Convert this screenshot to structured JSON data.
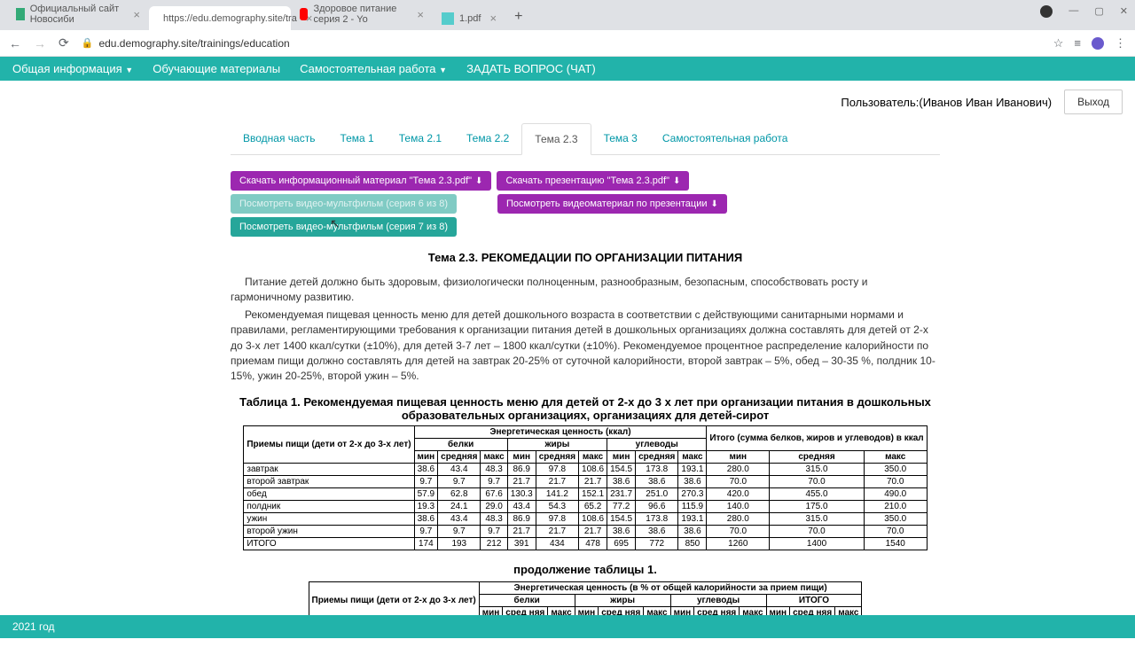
{
  "chrome": {
    "tabs": [
      "Официальный сайт Новосиби",
      "https://edu.demography.site/tra",
      "Здоровое питание серия 2 - Yo",
      "1.pdf"
    ],
    "new_tab": "+",
    "nav": {
      "back": "←",
      "forward": "→",
      "reload": "⟳"
    },
    "lock": "🔒",
    "url": "edu.demography.site/trainings/education",
    "star": "☆",
    "menu": "⋮",
    "close": "×",
    "win": {
      "min": "—",
      "max": "▢",
      "close": "✕"
    }
  },
  "site_nav": [
    "Общая информация",
    "Обучающие материалы",
    "Самостоятельная работа",
    "ЗАДАТЬ ВОПРОС (ЧАТ)"
  ],
  "user_row": {
    "label": "Пользователь:(Иванов Иван Иванович)",
    "logout": "Выход"
  },
  "tabs": [
    "Вводная часть",
    "Тема 1",
    "Тема 2.1",
    "Тема 2.2",
    "Тема 2.3",
    "Тема 3",
    "Самостоятельная работа"
  ],
  "active_tab": 4,
  "buttons": {
    "dl_info": "Скачать информационный материал \"Тема 2.3.pdf\"",
    "dl_pres": "Скачать презентацию \"Тема 2.3.pdf\"",
    "vid6": "Посмотреть видео-мультфильм (серия 6 из 8)",
    "vid7": "Посмотреть видео-мультфильм (серия 7 из 8)",
    "vid_pres": "Посмотреть видеоматериал по презентации"
  },
  "topic_title": "Тема 2.3. РЕКОМЕДАЦИИ ПО ОРГАНИЗАЦИИ ПИТАНИЯ",
  "para1": "Питание детей должно быть здоровым, физиологически полноценным, разнообразным, безопасным, способствовать росту и гармоничному развитию.",
  "para2": "Рекомендуемая пищевая ценность меню для детей дошкольного возраста в соответствии с действующими санитарными нормами и правилами, регламентирующими требования к организации питания детей в дошкольных организациях должна составлять для детей от 2-х до 3-х лет 1400 ккал/сутки (±10%), для детей 3-7 лет – 1800 ккал/сутки (±10%). Рекомендуемое процентное распределение калорийности по приемам пищи должно составлять для детей на завтрак 20-25% от суточной калорийности, второй завтрак – 5%, обед – 30-35 %, полдник 10-15%, ужин 20-25%, второй ужин – 5%.",
  "tbl_caption": "Таблица 1. Рекомендуемая пищевая ценность меню для детей от 2-х до 3 х лет при организации питания в дошкольных образовательных организациях, организациях для детей-сирот",
  "tbl_cont": "продолжение таблицы 1.",
  "footer": "2021 год",
  "t1": {
    "rowhead": "Приемы пищи (дети от 2-х до 3-х лет)",
    "e_title": "Энергетическая ценность (ккал)",
    "total_title": "Итого (сумма белков, жиров и углеводов) в ккал",
    "groups": [
      "белки",
      "жиры",
      "углеводы"
    ],
    "sub": [
      "мин",
      "средняя",
      "макс"
    ],
    "rows": [
      {
        "n": "завтрак",
        "v": [
          "38.6",
          "43.4",
          "48.3",
          "86.9",
          "97.8",
          "108.6",
          "154.5",
          "173.8",
          "193.1",
          "280.0",
          "315.0",
          "350.0"
        ]
      },
      {
        "n": "второй завтрак",
        "v": [
          "9.7",
          "9.7",
          "9.7",
          "21.7",
          "21.7",
          "21.7",
          "38.6",
          "38.6",
          "38.6",
          "70.0",
          "70.0",
          "70.0"
        ]
      },
      {
        "n": "обед",
        "v": [
          "57.9",
          "62.8",
          "67.6",
          "130.3",
          "141.2",
          "152.1",
          "231.7",
          "251.0",
          "270.3",
          "420.0",
          "455.0",
          "490.0"
        ]
      },
      {
        "n": "полдник",
        "v": [
          "19.3",
          "24.1",
          "29.0",
          "43.4",
          "54.3",
          "65.2",
          "77.2",
          "96.6",
          "115.9",
          "140.0",
          "175.0",
          "210.0"
        ]
      },
      {
        "n": "ужин",
        "v": [
          "38.6",
          "43.4",
          "48.3",
          "86.9",
          "97.8",
          "108.6",
          "154.5",
          "173.8",
          "193.1",
          "280.0",
          "315.0",
          "350.0"
        ]
      },
      {
        "n": "второй ужин",
        "v": [
          "9.7",
          "9.7",
          "9.7",
          "21.7",
          "21.7",
          "21.7",
          "38.6",
          "38.6",
          "38.6",
          "70.0",
          "70.0",
          "70.0"
        ]
      },
      {
        "n": "ИТОГО",
        "v": [
          "174",
          "193",
          "212",
          "391",
          "434",
          "478",
          "695",
          "772",
          "850",
          "1260",
          "1400",
          "1540"
        ]
      }
    ]
  },
  "t2": {
    "rowhead": "Приемы пищи (дети от 2-х до 3-х лет)",
    "e_title": "Энергетическая ценность (в % от общей калорийности за прием пищи)",
    "groups": [
      "белки",
      "жиры",
      "углеводы",
      "ИТОГО"
    ],
    "sub": [
      "мин",
      "сред няя",
      "макс"
    ]
  }
}
